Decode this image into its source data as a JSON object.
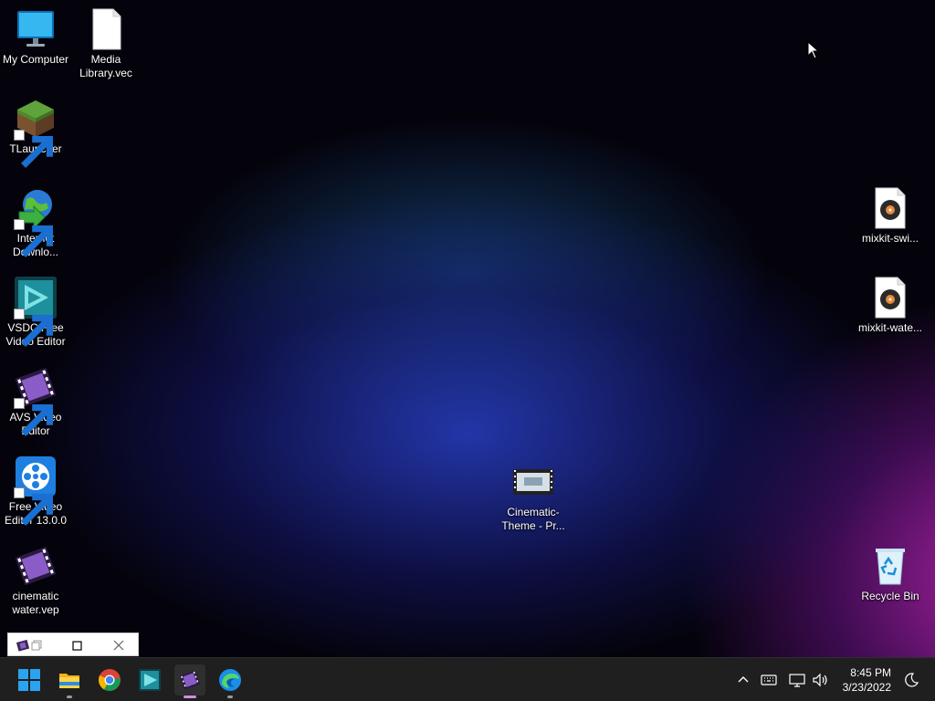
{
  "desktop": {
    "icons": [
      {
        "label": "My Computer"
      },
      {
        "label": "Media Library.vec"
      },
      {
        "label": "TLauncher"
      },
      {
        "label": "Internet Downlo..."
      },
      {
        "label": "VSDC Free Video Editor"
      },
      {
        "label": "AVS Video Editor"
      },
      {
        "label": "Free Video Editor 13.0.0"
      },
      {
        "label": "cinematic water.vep"
      },
      {
        "label": "Cinematic-Theme - Pr..."
      },
      {
        "label": "mixkit-swi..."
      },
      {
        "label": "mixkit-wate..."
      },
      {
        "label": "Recycle Bin"
      }
    ]
  },
  "taskbar": {
    "items": [
      {
        "name": "start",
        "icon": "windows-logo-icon"
      },
      {
        "name": "file-explorer",
        "icon": "folder-icon"
      },
      {
        "name": "chrome",
        "icon": "chrome-icon"
      },
      {
        "name": "vsdc",
        "icon": "vsdc-icon"
      },
      {
        "name": "avs-video-editor",
        "icon": "film-strip-icon"
      },
      {
        "name": "edge",
        "icon": "edge-icon"
      }
    ],
    "clock": {
      "time": "8:45 PM",
      "date": "3/23/2022"
    }
  },
  "colors": {
    "taskbar": "#1f1f1f",
    "accent": "#d28de6"
  }
}
